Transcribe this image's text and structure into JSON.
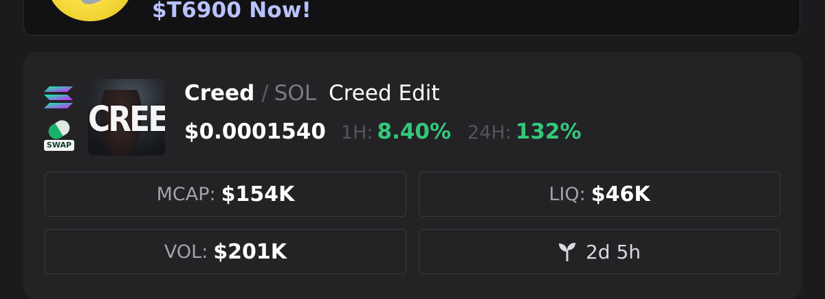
{
  "promo": {
    "text": "$T6900 Now!"
  },
  "token": {
    "name": "Creed",
    "pair_separator": "/",
    "quote": "SOL",
    "description": "Creed Edit",
    "image_text": "CREED",
    "price": "$0.0001540",
    "change_1h_label": "1H:",
    "change_1h": "8.40%",
    "change_24h_label": "24H:",
    "change_24h": "132%"
  },
  "badges": {
    "chain_icon": "solana-icon",
    "swap_label": "SWAP"
  },
  "stats": {
    "mcap_label": "MCAP:",
    "mcap_value": "$154K",
    "liq_label": "LIQ:",
    "liq_value": "$46K",
    "vol_label": "VOL:",
    "vol_value": "$201K",
    "age_icon": "sprout-icon",
    "age_value": "2d 5h"
  },
  "colors": {
    "positive": "#34c77b",
    "promo_text": "#b9c2ff",
    "background": "#1b1b1e",
    "card": "#232326"
  }
}
